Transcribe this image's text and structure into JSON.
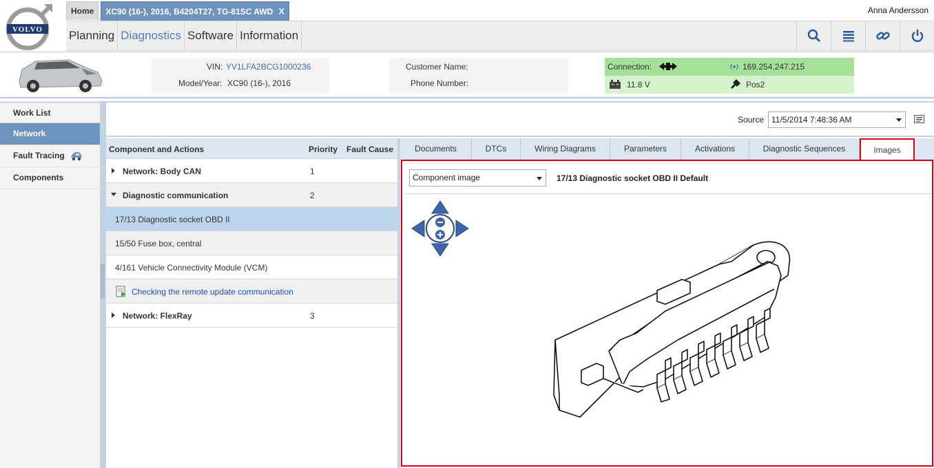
{
  "header": {
    "brand": "VOLVO",
    "tabs": {
      "home": "Home",
      "vehicle": "XC90 (16-), 2016, B4204T27, TG-81SC AWD",
      "close": "X"
    },
    "user": "Anna Andersson",
    "menu": [
      "Planning",
      "Diagnostics",
      "Software",
      "Information"
    ],
    "active_menu": "Diagnostics",
    "tools": [
      "search-icon",
      "list-icon",
      "link-icon",
      "power-icon"
    ]
  },
  "vehicle": {
    "vin_label": "VIN:",
    "vin": "YV1LFA2BCG1000236",
    "model_label": "Model/Year:",
    "model": "XC90 (16-), 2016",
    "customer_label": "Customer Name:",
    "phone_label": "Phone Number:",
    "connection_label": "Connection:",
    "ip": "169.254.247.215",
    "voltage": "11.8 V",
    "key_pos": "Pos2"
  },
  "nav": [
    "Work List",
    "Network",
    "Fault Tracing",
    "Components"
  ],
  "active_nav": "Network",
  "source": {
    "label": "Source",
    "value": "11/5/2014 7:48:36 AM"
  },
  "component_list": {
    "headers": {
      "component": "Component and Actions",
      "priority": "Priority",
      "fault": "Fault Cause"
    },
    "rows": [
      {
        "label": "Network: Body CAN",
        "priority": "1",
        "kind": "group-collapsed"
      },
      {
        "label": "Diagnostic communication",
        "priority": "2",
        "kind": "group-expanded"
      },
      {
        "label": "17/13 Diagnostic socket OBD II",
        "priority": "",
        "kind": "selected"
      },
      {
        "label": "15/50 Fuse box, central",
        "priority": "",
        "kind": "item"
      },
      {
        "label": "4/161 Vehicle Connectivity Module (VCM)",
        "priority": "",
        "kind": "item"
      },
      {
        "label": "Checking the remote update communication",
        "priority": "",
        "kind": "action"
      },
      {
        "label": "Network: FlexRay",
        "priority": "3",
        "kind": "group-collapsed"
      }
    ]
  },
  "detail": {
    "tabs": [
      "Documents",
      "DTCs",
      "Wiring Diagrams",
      "Parameters",
      "Activations",
      "Diagnostic Sequences",
      "Images"
    ],
    "active_tab": "Images",
    "image_select": "Component image",
    "image_title": "17/13 Diagnostic socket OBD II Default"
  },
  "colors": {
    "accent": "#6e93bd",
    "highlight": "#d9001b",
    "connection": "#a6e19a",
    "selected_row": "#bdd5ee"
  }
}
